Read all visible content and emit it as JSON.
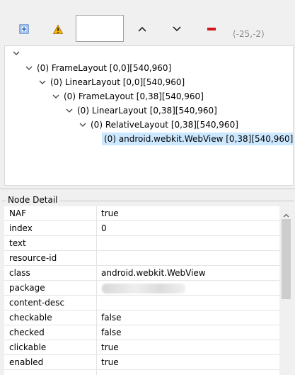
{
  "toolbar": {
    "coord_text": "(-25,-2)",
    "icons": [
      "expand-all-icon",
      "warning-icon",
      "chevron-up-icon",
      "chevron-down-icon",
      "remove-icon"
    ],
    "colors": {
      "warning": "#e8a000",
      "remove": "#d0161b",
      "expand": "#1f5fbf"
    }
  },
  "tree": {
    "nodes": [
      {
        "label": "(0) FrameLayout [0,0][540,960]"
      },
      {
        "label": "(0) LinearLayout [0,0][540,960]"
      },
      {
        "label": "(0) FrameLayout [0,38][540,960]"
      },
      {
        "label": "(0) LinearLayout [0,38][540,960]"
      },
      {
        "label": "(0) RelativeLayout [0,38][540,960]"
      },
      {
        "label": "(0) android.webkit.WebView [0,38][540,960]"
      }
    ],
    "selected_color": "#cce8ff"
  },
  "detail": {
    "title": "Node Detail",
    "rows": [
      {
        "key": "NAF",
        "value": "true"
      },
      {
        "key": "index",
        "value": "0"
      },
      {
        "key": "text",
        "value": ""
      },
      {
        "key": "resource-id",
        "value": ""
      },
      {
        "key": "class",
        "value": "android.webkit.WebView"
      },
      {
        "key": "package",
        "value": ""
      },
      {
        "key": "content-desc",
        "value": ""
      },
      {
        "key": "checkable",
        "value": "false"
      },
      {
        "key": "checked",
        "value": "false"
      },
      {
        "key": "clickable",
        "value": "true"
      },
      {
        "key": "enabled",
        "value": "true"
      }
    ]
  }
}
